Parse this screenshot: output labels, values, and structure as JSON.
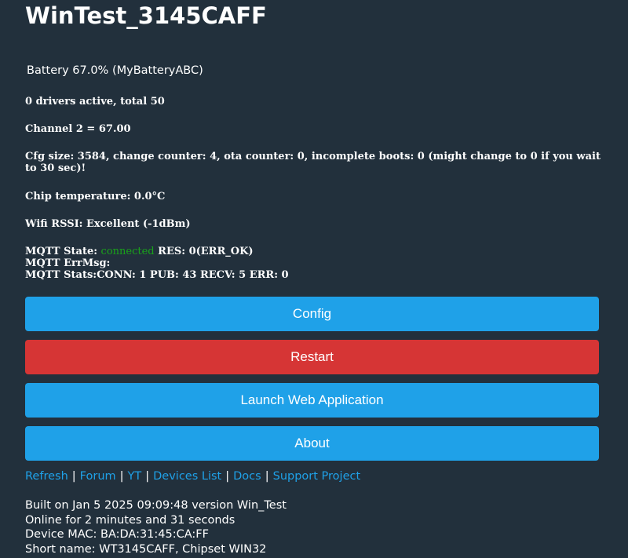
{
  "device": {
    "title": "WinTest_3145CAFF"
  },
  "status": {
    "battery": "Battery 67.0% (MyBatteryABC)",
    "drivers": "0 drivers active, total 50",
    "channel": "Channel 2 = 67.00",
    "cfg": "Cfg size: 3584, change counter: 4, ota counter: 0, incomplete boots: 0 (might change to 0 if you wait to 30 sec)!",
    "chip_temp": "Chip temperature: 0.0°C",
    "wifi": "Wifi RSSI: Excellent (-1dBm)",
    "mqtt": {
      "state_label": "MQTT State:",
      "state_value": "connected",
      "res": "RES: 0(ERR_OK)",
      "errmsg": "MQTT ErrMsg:",
      "stats": "MQTT Stats:CONN: 1 PUB: 43 RECV: 5 ERR: 0"
    }
  },
  "buttons": {
    "config": "Config",
    "restart": "Restart",
    "launch": "Launch Web Application",
    "about": "About"
  },
  "links": {
    "refresh": "Refresh",
    "forum": "Forum",
    "yt": "YT",
    "devices_list": "Devices List",
    "docs": "Docs",
    "support": "Support Project",
    "separator": "|"
  },
  "footer": {
    "built": "Built on Jan 5 2025 09:09:48 version Win_Test",
    "online": "Online for 2 minutes and 31 seconds",
    "mac": "Device MAC: BA:DA:31:45:CA:FF",
    "short_name": "Short name: WT3145CAFF, Chipset WIN32"
  },
  "colors": {
    "background": "#22303c",
    "button_blue": "#1fa1e8",
    "button_red": "#d63535",
    "connected_green": "#1aa31a",
    "link": "#1fa1e8"
  }
}
